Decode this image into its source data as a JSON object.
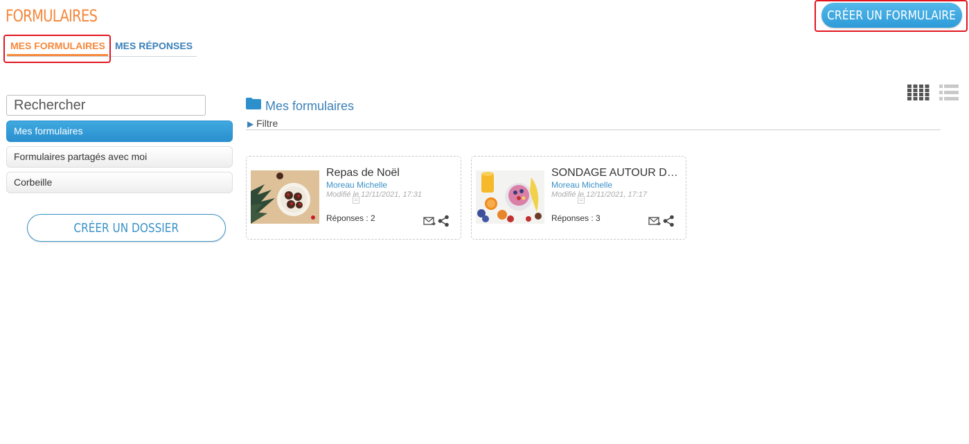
{
  "header": {
    "app_title": "FORMULAIRES",
    "create_form_label": "CRÉER UN FORMULAIRE"
  },
  "tabs": [
    {
      "label": "MES FORMULAIRES",
      "active": true
    },
    {
      "label": "MES RÉPONSES",
      "active": false
    }
  ],
  "sidebar": {
    "search_placeholder": "Rechercher",
    "items": [
      {
        "label": "Mes formulaires",
        "active": true
      },
      {
        "label": "Formulaires partagés avec moi",
        "active": false
      },
      {
        "label": "Corbeille",
        "active": false
      }
    ],
    "create_folder_label": "CRÉER UN DOSSIER"
  },
  "main": {
    "heading": "Mes formulaires",
    "filter_label": "Filtre",
    "filter_icon": "triangle-right-icon",
    "view_icons": [
      "grid-view-icon",
      "list-view-icon"
    ],
    "cards": [
      {
        "title": "Repas de Noël",
        "author": "Moreau Michelle",
        "modified": "Modifié le 12/11/2021, 17:31",
        "responses": "Réponses : 2"
      },
      {
        "title": "SONDAGE AUTOUR DU PETIT DÉJEUNER",
        "author": "Moreau Michelle",
        "modified": "Modifié le 12/11/2021, 17:17",
        "responses": "Réponses : 3"
      }
    ]
  },
  "colors": {
    "brand_orange": "#f5883b",
    "accent_blue": "#2d9bd8",
    "link_blue": "#3a80b8",
    "highlight_red": "#e2141e"
  }
}
